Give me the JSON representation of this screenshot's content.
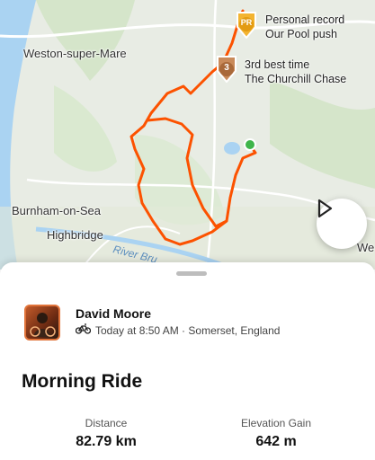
{
  "map": {
    "places": {
      "weston": "Weston-super-Mare",
      "burnham": "Burnham-on-Sea",
      "highbridge": "Highbridge",
      "river": "River Bru",
      "edge_we": "We"
    },
    "achievements": [
      {
        "badge": "PR",
        "line1": "Personal record",
        "line2": "Our Pool push"
      },
      {
        "badge": "3",
        "line1": "3rd best time",
        "line2": "The Churchill Chase"
      }
    ],
    "colors": {
      "route": "#fc5200",
      "start": "#3fb54a",
      "water": "#aad3f2",
      "land": "#e8ece4"
    },
    "play_icon": "play-icon"
  },
  "activity": {
    "athlete": "David Moore",
    "meta": "Today at 8:50 AM · Somerset, England",
    "sport_icon": "bike-icon",
    "title": "Morning Ride",
    "stats": [
      {
        "label": "Distance",
        "value": "82.79 km"
      },
      {
        "label": "Elevation Gain",
        "value": "642 m"
      }
    ]
  }
}
